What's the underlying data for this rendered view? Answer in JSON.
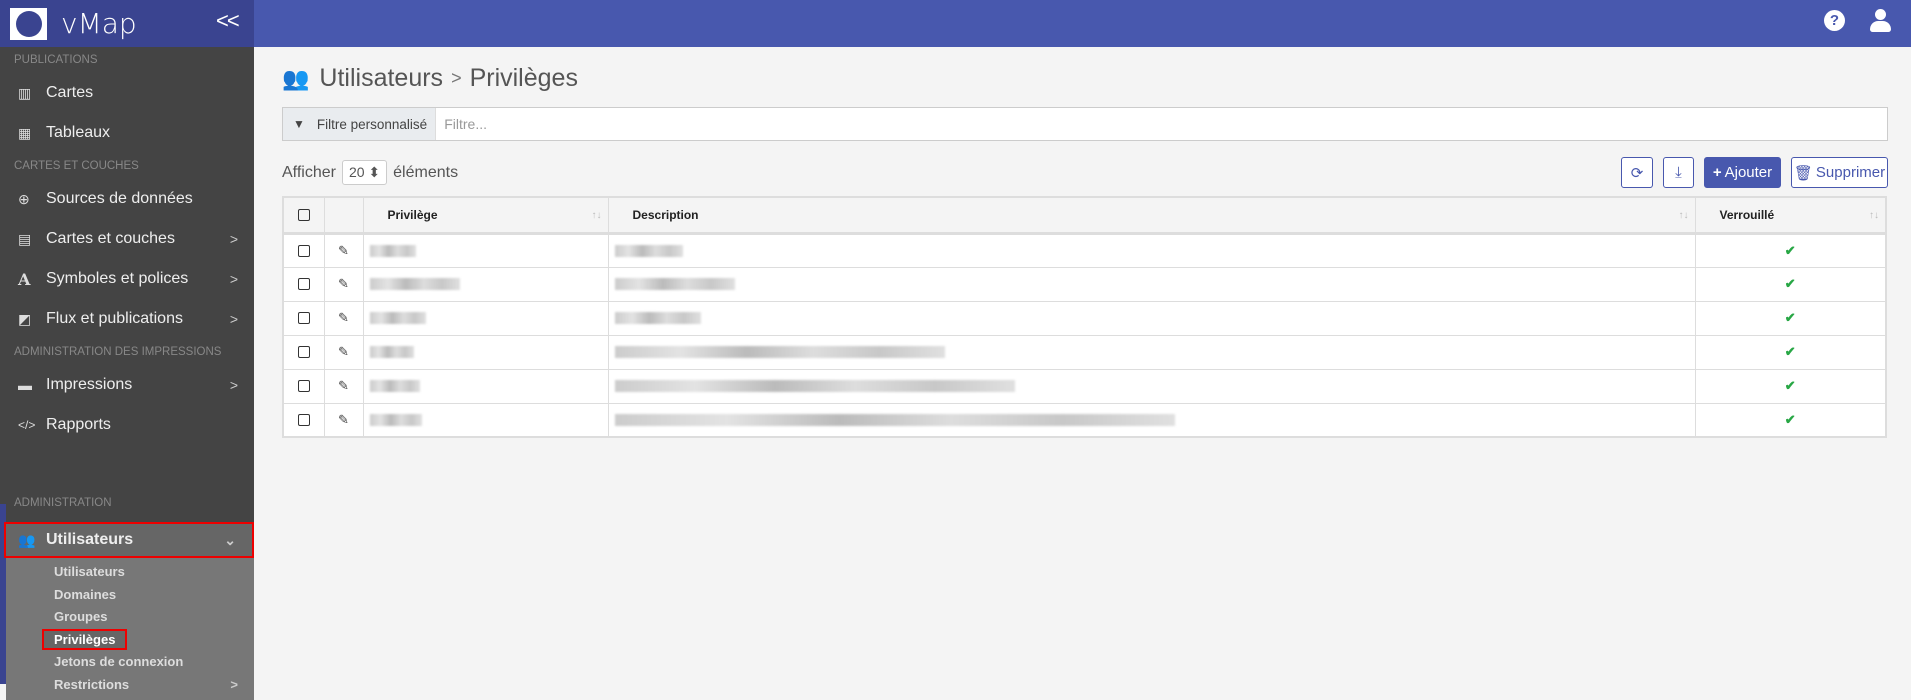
{
  "app": {
    "brand": "vMap",
    "collapse_icon": "chevrons-left-icon"
  },
  "sidebar": {
    "sections": [
      {
        "label": "PUBLICATIONS",
        "items": [
          {
            "label": "Cartes",
            "icon": "map-icon"
          },
          {
            "label": "Tableaux",
            "icon": "table-icon"
          }
        ]
      },
      {
        "label": "CARTES ET COUCHES",
        "items": [
          {
            "label": "Sources de données",
            "icon": "globe-icon"
          },
          {
            "label": "Cartes et couches",
            "icon": "atlas-icon",
            "submenu": true
          },
          {
            "label": "Symboles et polices",
            "icon": "font-icon",
            "submenu": true
          },
          {
            "label": "Flux et publications",
            "icon": "share-icon",
            "submenu": true
          }
        ]
      },
      {
        "label": "ADMINISTRATION DES IMPRESSIONS",
        "items": [
          {
            "label": "Impressions",
            "icon": "print-icon",
            "submenu": true
          },
          {
            "label": "Rapports",
            "icon": "code-icon"
          }
        ]
      },
      {
        "label": "ADMINISTRATION",
        "items": [
          {
            "label": "Utilisateurs",
            "icon": "users-icon",
            "expanded": true
          }
        ]
      }
    ],
    "subitems": [
      "Utilisateurs",
      "Domaines",
      "Groupes",
      "Privilèges",
      "Jetons de connexion",
      "Restrictions"
    ],
    "selected_subitem": "Privilèges"
  },
  "header": {
    "help_icon": "question-circle-icon",
    "user_icon": "user-icon"
  },
  "page": {
    "breadcrumb_parent": "Utilisateurs",
    "breadcrumb_sep": ">",
    "breadcrumb_current": "Privilèges"
  },
  "filter": {
    "label": "Filtre personnalisé",
    "placeholder": "Filtre...",
    "value": ""
  },
  "pagination": {
    "show_label": "Afficher",
    "page_size": "20",
    "suffix": "éléments"
  },
  "toolbar": {
    "add_label": "Ajouter",
    "delete_label": "Supprimer"
  },
  "table": {
    "columns": [
      "Privilège",
      "Description",
      "Verrouillé"
    ],
    "rows": [
      {
        "locked": true
      },
      {
        "locked": true
      },
      {
        "locked": true
      },
      {
        "locked": true
      },
      {
        "locked": true
      },
      {
        "locked": true
      }
    ]
  },
  "colors": {
    "primary": "#4858ae",
    "sidebar": "#444444",
    "success": "#28a745",
    "highlight": "#ee0000"
  }
}
